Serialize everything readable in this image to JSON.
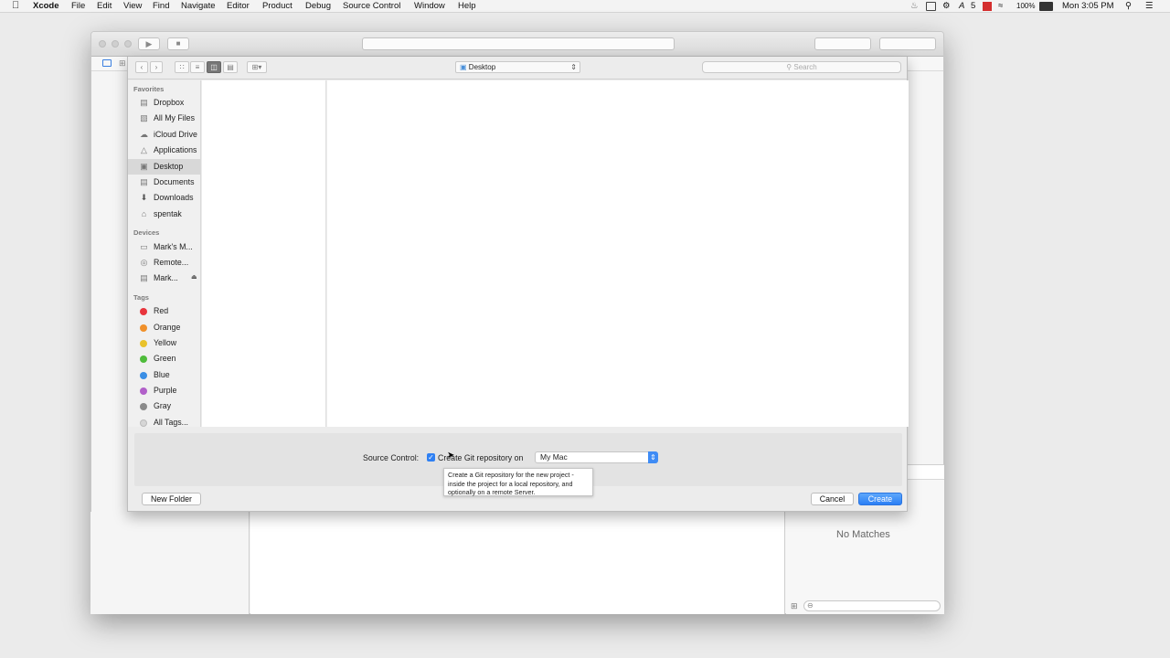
{
  "menubar": {
    "app": "Xcode",
    "menus": [
      "File",
      "Edit",
      "View",
      "Find",
      "Navigate",
      "Editor",
      "Product",
      "Debug",
      "Source Control",
      "Window",
      "Help"
    ],
    "status": {
      "badge_count": "5",
      "battery": "100%",
      "clock": "Mon 3:05 PM"
    }
  },
  "sheet": {
    "location": "Desktop",
    "search_placeholder": "Search",
    "sidebar": {
      "favorites_header": "Favorites",
      "favorites": [
        {
          "label": "Dropbox",
          "icon": "folder-icon"
        },
        {
          "label": "All My Files",
          "icon": "all-files-icon"
        },
        {
          "label": "iCloud Drive",
          "icon": "cloud-icon"
        },
        {
          "label": "Applications",
          "icon": "applications-icon"
        },
        {
          "label": "Desktop",
          "icon": "desktop-icon",
          "selected": true
        },
        {
          "label": "Documents",
          "icon": "documents-icon"
        },
        {
          "label": "Downloads",
          "icon": "downloads-icon"
        },
        {
          "label": "spentak",
          "icon": "home-icon"
        }
      ],
      "devices_header": "Devices",
      "devices": [
        {
          "label": "Mark's M...",
          "icon": "laptop-icon"
        },
        {
          "label": "Remote...",
          "icon": "disc-icon"
        },
        {
          "label": "Mark...",
          "icon": "drive-icon"
        }
      ],
      "tags_header": "Tags",
      "tags": [
        {
          "label": "Red",
          "color": "#e8343c"
        },
        {
          "label": "Orange",
          "color": "#f0902a"
        },
        {
          "label": "Yellow",
          "color": "#e9c22b"
        },
        {
          "label": "Green",
          "color": "#4fbc3b"
        },
        {
          "label": "Blue",
          "color": "#3a8ee5"
        },
        {
          "label": "Purple",
          "color": "#b160c9"
        },
        {
          "label": "Gray",
          "color": "#8a8a8a"
        },
        {
          "label": "All Tags...",
          "color": "#d6d6d6"
        }
      ]
    },
    "source_control_label": "Source Control:",
    "create_git_label": "Create Git repository on",
    "create_git_checked": true,
    "repo_location": "My Mac",
    "tooltip": "Create a Git repository for the new project - inside the project for a local repository, and optionally on a remote Server.",
    "new_folder": "New Folder",
    "cancel": "Cancel",
    "create": "Create"
  },
  "library": {
    "no_matches": "No Matches"
  }
}
